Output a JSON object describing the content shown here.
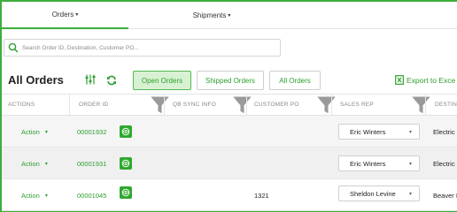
{
  "nav": {
    "orders_label": "Orders",
    "shipments_label": "Shipments",
    "caret": "▾"
  },
  "search": {
    "placeholder": "Search Order ID, Destination, Customer PO..."
  },
  "header": {
    "title": "All Orders",
    "filters": {
      "open": "Open Orders",
      "shipped": "Shipped Orders",
      "all": "All Orders"
    },
    "active_filter": "open",
    "export_label": "Export to Exce"
  },
  "table": {
    "columns": [
      "ACTIONS",
      "ORDER ID",
      "QB SYNC INFO",
      "CUSTOMER PO",
      "SALES REP",
      "DESTIN"
    ],
    "rows": [
      {
        "action": "Action",
        "order_id": "00001932",
        "qb_sync": "",
        "customer_po": "",
        "sales_rep": "Eric Winters",
        "destination": "Electric"
      },
      {
        "action": "Action",
        "order_id": "00001931",
        "qb_sync": "",
        "customer_po": "",
        "sales_rep": "Eric Winters",
        "destination": "Electric"
      },
      {
        "action": "Action",
        "order_id": "00001045",
        "qb_sync": "",
        "customer_po": "1321",
        "sales_rep": "Sheldon Levine",
        "destination": "Beaver I"
      }
    ]
  },
  "colors": {
    "accent": "#3cae3c",
    "accent_text": "#2f9e2f",
    "active_bg": "#d8f1d3",
    "row_alt": "#f5f5f5"
  },
  "icons": [
    "search-icon",
    "filter-sliders-icon",
    "refresh-icon",
    "export-excel-icon",
    "column-filter-icon",
    "eye-icon",
    "chevron-down-icon"
  ]
}
